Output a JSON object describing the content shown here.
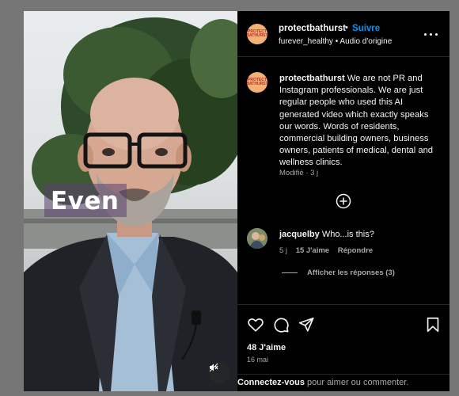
{
  "header": {
    "username": "protectbathurst",
    "separator": "•",
    "follow_label": "Suivre",
    "subtitle": "furever_healthy • Audio d'origine",
    "avatar_text": "PROTECT BATHURST"
  },
  "video": {
    "caption": "Even",
    "mute_icon": "speaker-muted-icon"
  },
  "post": {
    "username": "protectbathurst",
    "text": "We are not PR and Instagram professionals. We are just regular people who used this AI generated video which exactly speaks our words. Words of residents, commercial building owners, business owners, patients of medical, dental and wellness clinics.",
    "meta": "Modifié · 3 j"
  },
  "comment": {
    "username": "jacquelby",
    "text": "Who...is this?",
    "age": "5 j",
    "likes": "15 J'aime",
    "reply_label": "Répondre",
    "view_replies": "Afficher les réponses (3)"
  },
  "actions": {
    "likes_count": "48 J'aime",
    "date": "16 mai",
    "login_link": "Connectez-vous",
    "login_suffix": " pour aimer ou commenter."
  },
  "colors": {
    "follow": "#0095f6",
    "panel_bg": "#000000",
    "secondary_text": "#a8a8a8",
    "backdrop": "#767676"
  }
}
